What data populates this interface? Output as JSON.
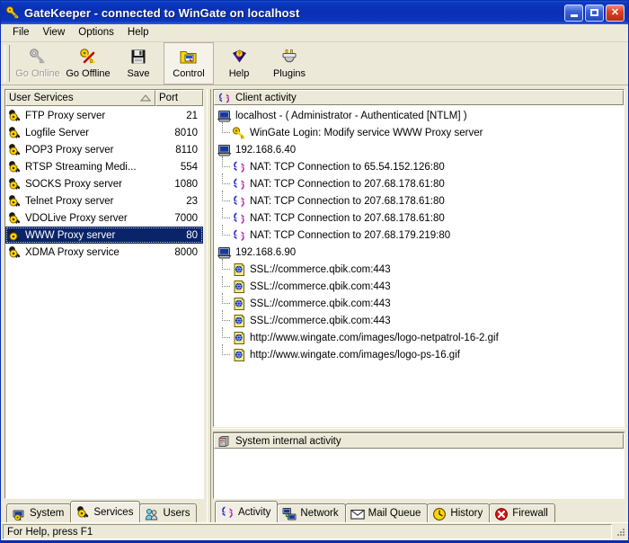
{
  "window": {
    "title": "GateKeeper - connected to WinGate on localhost",
    "title_icon": "key-icon",
    "minimize_label": "Minimize",
    "maximize_label": "Maximize",
    "close_label": "Close"
  },
  "menu": {
    "items": [
      {
        "label": "File",
        "name": "menu-file"
      },
      {
        "label": "View",
        "name": "menu-view"
      },
      {
        "label": "Options",
        "name": "menu-options"
      },
      {
        "label": "Help",
        "name": "menu-help"
      }
    ]
  },
  "toolbar": {
    "buttons": [
      {
        "label": "Go Online",
        "icon": "key-grey-icon",
        "state": "disabled"
      },
      {
        "label": "Go Offline",
        "icon": "key-cancel-icon",
        "state": "enabled"
      },
      {
        "label": "Save",
        "icon": "floppy-disk-icon",
        "state": "enabled"
      },
      {
        "label": "Control",
        "icon": "control-folder-icon",
        "state": "active"
      },
      {
        "label": "Help",
        "icon": "help-book-icon",
        "state": "enabled"
      },
      {
        "label": "Plugins",
        "icon": "plugin-icon",
        "state": "enabled"
      }
    ]
  },
  "services_panel": {
    "columns": [
      "User Services",
      "Port"
    ],
    "sort_indicator": "ascending-arrow-icon",
    "rows": [
      {
        "name": "FTP Proxy server",
        "port": "21",
        "icon": "service-key-icon",
        "selected": false
      },
      {
        "name": "Logfile Server",
        "port": "8010",
        "icon": "service-key-icon",
        "selected": false
      },
      {
        "name": "POP3 Proxy server",
        "port": "8110",
        "icon": "service-key-icon",
        "selected": false
      },
      {
        "name": "RTSP Streaming Medi...",
        "port": "554",
        "icon": "service-key-icon",
        "selected": false
      },
      {
        "name": "SOCKS Proxy server",
        "port": "1080",
        "icon": "service-key-icon",
        "selected": false
      },
      {
        "name": "Telnet Proxy server",
        "port": "23",
        "icon": "service-key-icon",
        "selected": false
      },
      {
        "name": "VDOLive Proxy server",
        "port": "7000",
        "icon": "service-key-icon",
        "selected": false
      },
      {
        "name": "WWW Proxy server",
        "port": "80",
        "icon": "service-key-icon",
        "selected": true
      },
      {
        "name": "XDMA Proxy service",
        "port": "8000",
        "icon": "service-key-icon",
        "selected": false
      }
    ],
    "tabs": [
      {
        "label": "System",
        "icon": "system-icon",
        "active": false
      },
      {
        "label": "Services",
        "icon": "services-key-icon",
        "active": true
      },
      {
        "label": "Users",
        "icon": "users-icon",
        "active": false
      }
    ]
  },
  "activity_panel": {
    "header": {
      "label": "Client activity",
      "icon": "arrows-exchange-icon"
    },
    "nodes": [
      {
        "level": 0,
        "icon": "computer-icon",
        "label": "localhost  -  ( Administrator  -  Authenticated [NTLM] )"
      },
      {
        "level": 1,
        "icon": "key-icon",
        "label": "WinGate Login: Modify service WWW Proxy server"
      },
      {
        "level": 0,
        "icon": "computer-icon",
        "label": "192.168.6.40"
      },
      {
        "level": 1,
        "icon": "arrows-exchange-icon",
        "label": "NAT: TCP Connection to 65.54.152.126:80"
      },
      {
        "level": 1,
        "icon": "arrows-exchange-icon",
        "label": "NAT: TCP Connection to 207.68.178.61:80"
      },
      {
        "level": 1,
        "icon": "arrows-exchange-icon",
        "label": "NAT: TCP Connection to 207.68.178.61:80"
      },
      {
        "level": 1,
        "icon": "arrows-exchange-icon",
        "label": "NAT: TCP Connection to 207.68.178.61:80"
      },
      {
        "level": 1,
        "icon": "arrows-exchange-icon",
        "label": "NAT: TCP Connection to 207.68.179.219:80"
      },
      {
        "level": 0,
        "icon": "computer-icon",
        "label": "192.168.6.90"
      },
      {
        "level": 1,
        "icon": "www-page-icon",
        "label": "SSL://commerce.qbik.com:443"
      },
      {
        "level": 1,
        "icon": "www-page-icon",
        "label": "SSL://commerce.qbik.com:443"
      },
      {
        "level": 1,
        "icon": "www-page-icon",
        "label": "SSL://commerce.qbik.com:443"
      },
      {
        "level": 1,
        "icon": "www-page-icon",
        "label": "SSL://commerce.qbik.com:443"
      },
      {
        "level": 1,
        "icon": "www-page-icon",
        "label": "http://www.wingate.com/images/logo-netpatrol-16-2.gif"
      },
      {
        "level": 1,
        "icon": "www-page-icon",
        "label": "http://www.wingate.com/images/logo-ps-16.gif"
      }
    ],
    "system_header": {
      "label": "System internal activity",
      "icon": "server-box-icon"
    },
    "system_nodes": [],
    "tabs": [
      {
        "label": "Activity",
        "icon": "arrows-exchange-icon",
        "active": true
      },
      {
        "label": "Network",
        "icon": "network-icon",
        "active": false
      },
      {
        "label": "Mail Queue",
        "icon": "envelope-icon",
        "active": false
      },
      {
        "label": "History",
        "icon": "clock-icon",
        "active": false
      },
      {
        "label": "Firewall",
        "icon": "firewall-deny-icon",
        "active": false
      }
    ]
  },
  "statusbar": {
    "text": "For Help, press F1",
    "grip": "resize-grip-icon"
  },
  "colors": {
    "title_bar": "#0a2fb4",
    "face": "#ece9d8",
    "selection": "#0a246a",
    "accent_yellow": "#ffd700"
  }
}
